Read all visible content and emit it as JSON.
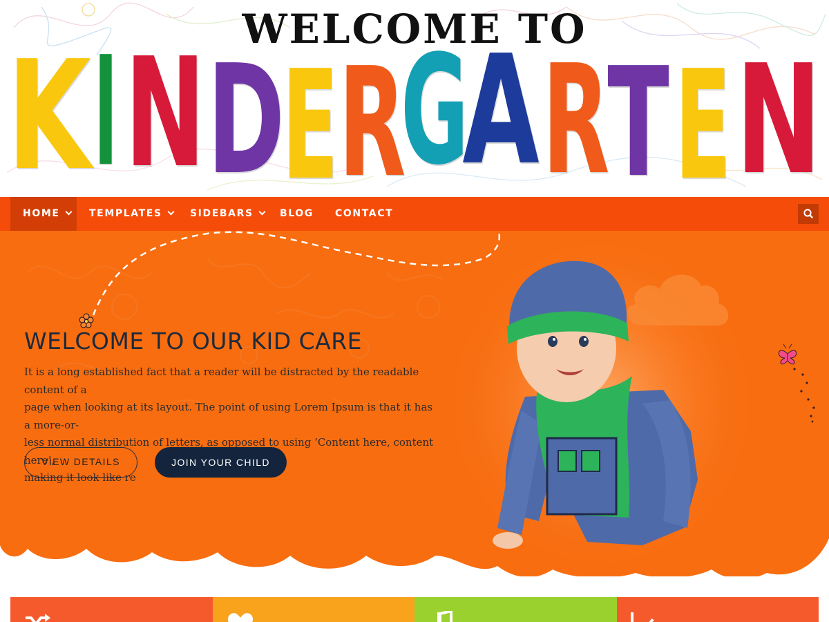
{
  "header": {
    "welcome_line": "WELCOME TO",
    "logo_letters": [
      {
        "char": "K",
        "color": "#f9c80e"
      },
      {
        "char": "I",
        "color": "#14923b"
      },
      {
        "char": "N",
        "color": "#d7193a"
      },
      {
        "char": "D",
        "color": "#6f35a5"
      },
      {
        "char": "E",
        "color": "#f9c80e"
      },
      {
        "char": "R",
        "color": "#f05a1a"
      },
      {
        "char": "G",
        "color": "#14a0b4"
      },
      {
        "char": "A",
        "color": "#1d3b9a"
      },
      {
        "char": "R",
        "color": "#f05a1a"
      },
      {
        "char": "T",
        "color": "#6f35a5"
      },
      {
        "char": "E",
        "color": "#f9c80e"
      },
      {
        "char": "N",
        "color": "#d7193a"
      }
    ]
  },
  "nav": {
    "items": [
      {
        "label": "HOME",
        "has_dropdown": true,
        "active": true
      },
      {
        "label": "TEMPLATES",
        "has_dropdown": true,
        "active": false
      },
      {
        "label": "SIDEBARS",
        "has_dropdown": true,
        "active": false
      },
      {
        "label": "BLOG",
        "has_dropdown": false,
        "active": false
      },
      {
        "label": "CONTACT",
        "has_dropdown": false,
        "active": false
      }
    ],
    "search_icon": "search-icon"
  },
  "hero": {
    "title": "WELCOME TO OUR KID CARE",
    "lines": [
      "It is a long established fact that a reader will be distracted by the readable content of a",
      "page when looking at its layout. The point of using Lorem Ipsum is that it has a more-or-",
      "less normal distribution of letters, as opposed to using ‘Content here, content here’,",
      "making it look like re"
    ],
    "primary_button": "VIEW DETAILS",
    "secondary_button": "JOIN YOUR CHILD"
  },
  "features": {
    "tiles": [
      {
        "icon": "shuffle-icon",
        "color": "#f55a2c"
      },
      {
        "icon": "heart-icon",
        "color": "#f9a21b"
      },
      {
        "icon": "music-icon",
        "color": "#9ad12f"
      },
      {
        "icon": "chart-icon",
        "color": "#f55a2c"
      }
    ]
  },
  "theme": {
    "nav_color": "#f54c0a",
    "hero_orange": "#f86d10",
    "dark_navy": "#14243d"
  }
}
